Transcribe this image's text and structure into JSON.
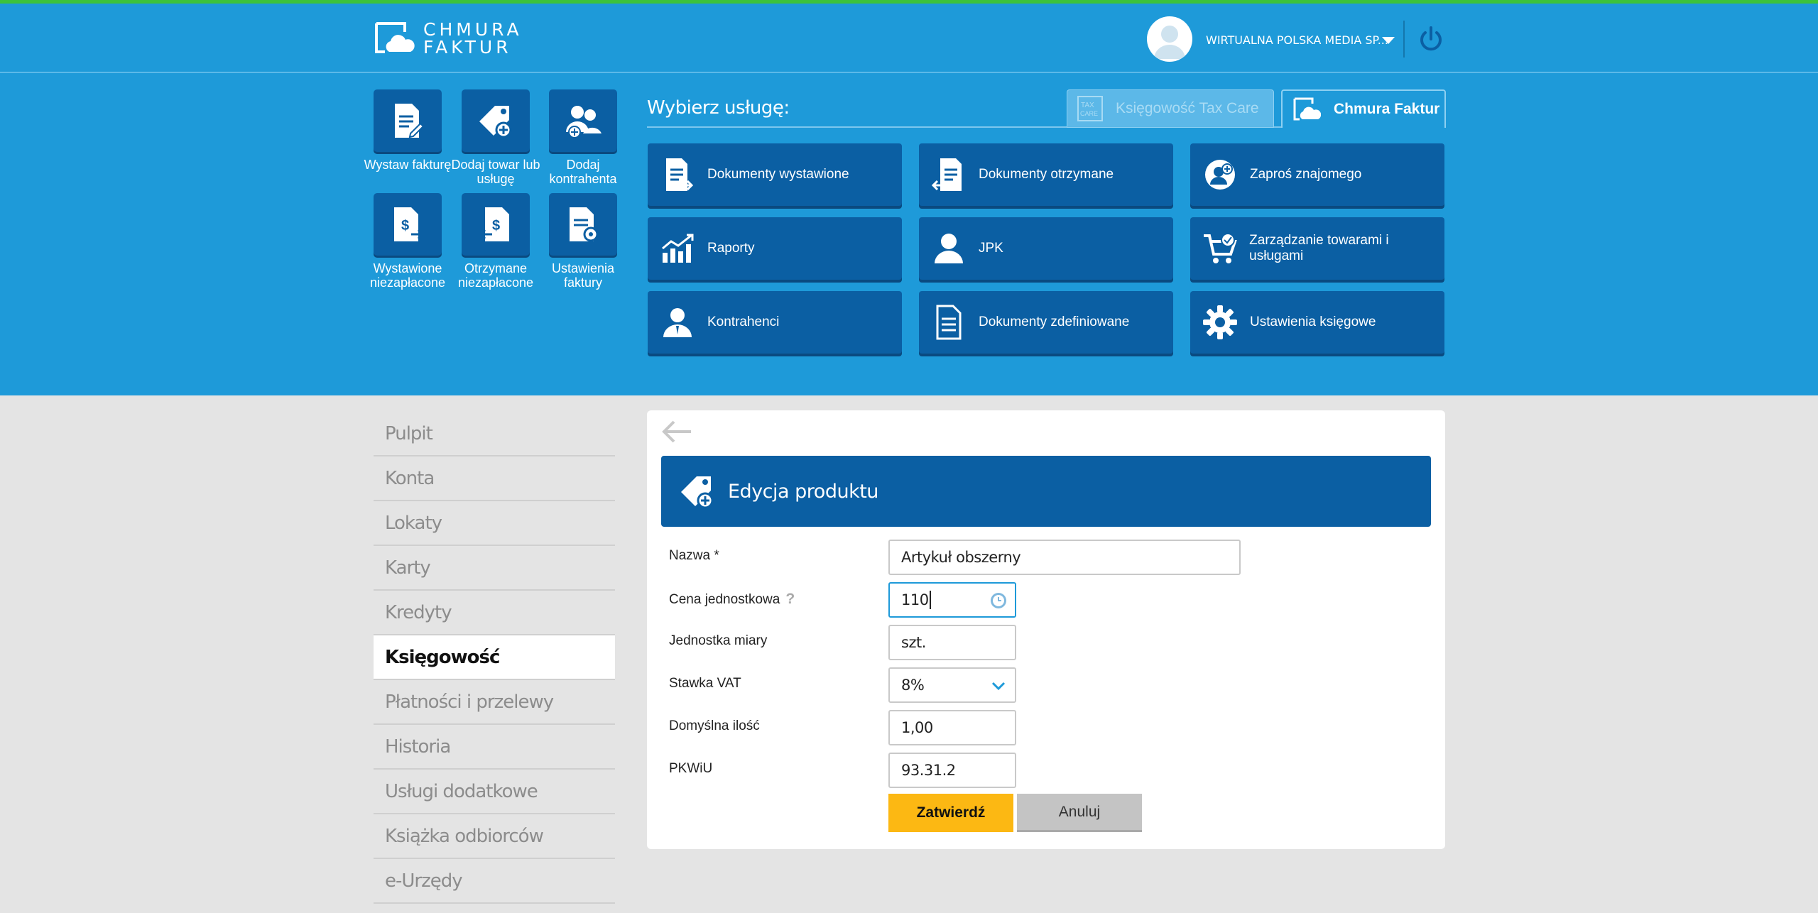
{
  "brand": {
    "line1": "CHMURA",
    "line2": "FAKTUR"
  },
  "user": {
    "company": "WIRTUALNA POLSKA MEDIA SP..."
  },
  "quick_actions": [
    {
      "label": "Wystaw fakturę",
      "icon": "invoice-edit-icon"
    },
    {
      "label": "Dodaj towar lub usługę",
      "icon": "tag-plus-icon"
    },
    {
      "label": "Dodaj kontrahenta",
      "icon": "users-plus-icon"
    },
    {
      "label": "Wystawione niezapłacone",
      "icon": "invoice-out-icon"
    },
    {
      "label": "Otrzymane niezapłacone",
      "icon": "invoice-in-icon"
    },
    {
      "label": "Ustawienia faktury",
      "icon": "invoice-settings-icon"
    }
  ],
  "services": {
    "heading": "Wybierz usługę:",
    "tabs": [
      {
        "label": "Księgowość Tax Care",
        "active": false
      },
      {
        "label": "Chmura Faktur",
        "active": true
      }
    ],
    "tiles": [
      {
        "label": "Dokumenty wystawione",
        "icon": "document-out-icon"
      },
      {
        "label": "Dokumenty otrzymane",
        "icon": "document-in-icon"
      },
      {
        "label": "Zaproś znajomego",
        "icon": "invite-friend-icon"
      },
      {
        "label": "Raporty",
        "icon": "chart-icon"
      },
      {
        "label": "JPK",
        "icon": "person-icon"
      },
      {
        "label": "Zarządzanie towarami i usługami",
        "icon": "cart-icon"
      },
      {
        "label": "Kontrahenci",
        "icon": "contractor-icon"
      },
      {
        "label": "Dokumenty zdefiniowane",
        "icon": "document-list-icon"
      },
      {
        "label": "Ustawienia księgowe",
        "icon": "gear-icon"
      }
    ]
  },
  "sidebar": {
    "items": [
      {
        "label": "Pulpit",
        "active": false
      },
      {
        "label": "Konta",
        "active": false
      },
      {
        "label": "Lokaty",
        "active": false
      },
      {
        "label": "Karty",
        "active": false
      },
      {
        "label": "Kredyty",
        "active": false
      },
      {
        "label": "Księgowość",
        "active": true
      },
      {
        "label": "Płatności i przelewy",
        "active": false
      },
      {
        "label": "Historia",
        "active": false
      },
      {
        "label": "Usługi dodatkowe",
        "active": false
      },
      {
        "label": "Książka odbiorców",
        "active": false
      },
      {
        "label": "e-Urzędy",
        "active": false
      }
    ]
  },
  "form": {
    "title": "Edycja produktu",
    "fields": {
      "name": {
        "label": "Nazwa *",
        "value": "Artykuł obszerny"
      },
      "price": {
        "label": "Cena jednostkowa",
        "help": "?",
        "value": "110"
      },
      "unit": {
        "label": "Jednostka miary",
        "value": "szt."
      },
      "vat": {
        "label": "Stawka VAT",
        "value": "8%"
      },
      "qty": {
        "label": "Domyślna ilość",
        "value": "1,00"
      },
      "pkwiu": {
        "label": "PKWiU",
        "value": "93.31.2"
      }
    },
    "submit_label": "Zatwierdź",
    "cancel_label": "Anuluj"
  },
  "colors": {
    "header": "#1e9ad9",
    "tile": "#0b5fa3",
    "accent_bar": "#3cc23c",
    "submit": "#fcb813"
  }
}
